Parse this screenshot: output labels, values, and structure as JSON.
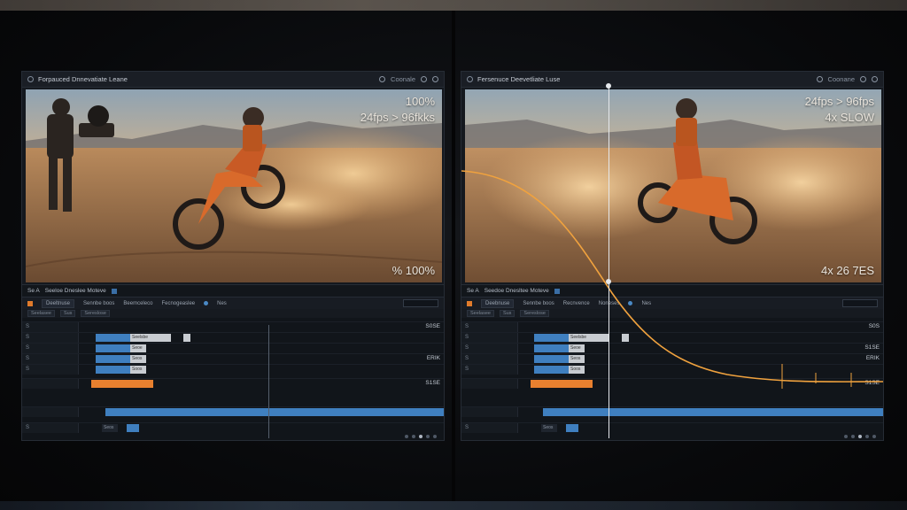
{
  "left_panel": {
    "title": "Forpauced Dnnevatiate Leane",
    "title_right": "Coonale",
    "overlay_top": "100%",
    "overlay_fps": "24fps > 96fkks",
    "overlay_bottom": "% 100%",
    "timeline_title": "Seeloe  Dneslee Moteve",
    "tl_prefix": "Se A",
    "toolbar": [
      "Deeltnuse",
      "Sennbe boos",
      "Beemceleco",
      "Fecnogeaslee",
      "Nes"
    ],
    "ruler": [
      "Seelasee",
      "Sus",
      "Sereslose"
    ],
    "track_labels": [
      "S",
      "S",
      "S",
      "S",
      "S",
      "",
      "",
      "S"
    ],
    "clip_labels": [
      "Seelsbe",
      "Seoe",
      "Seos",
      "Soos",
      "Seos"
    ],
    "row_right": [
      "S0SE",
      "ERIK",
      "S1SE"
    ],
    "accent": "#e8802f"
  },
  "right_panel": {
    "title": "Fersenuce Deevetliate Luse",
    "title_right": "Coonane",
    "overlay_fps": "24fps > 96fps",
    "overlay_slow": "4x SLOW",
    "overlay_bottom": "4x 26 7ES",
    "timeline_title": "Seedoe  Dnesltee Moteve",
    "tl_prefix": "Se A",
    "toolbar": [
      "Deebnuse",
      "Sennbe boos",
      "Recnvence",
      "Noneses",
      "Nes"
    ],
    "ruler": [
      "Seelasee",
      "Sus",
      "Sereslose"
    ],
    "track_labels": [
      "S",
      "S",
      "S",
      "S",
      "S",
      "",
      "",
      "S"
    ],
    "clip_labels": [
      "Seelsbe",
      "Seoe",
      "Seos",
      "Soos",
      "Seos"
    ],
    "row_right": [
      "S0S",
      "S1SE",
      "ERIK",
      "S1SE"
    ],
    "accent": "#e8802f"
  }
}
